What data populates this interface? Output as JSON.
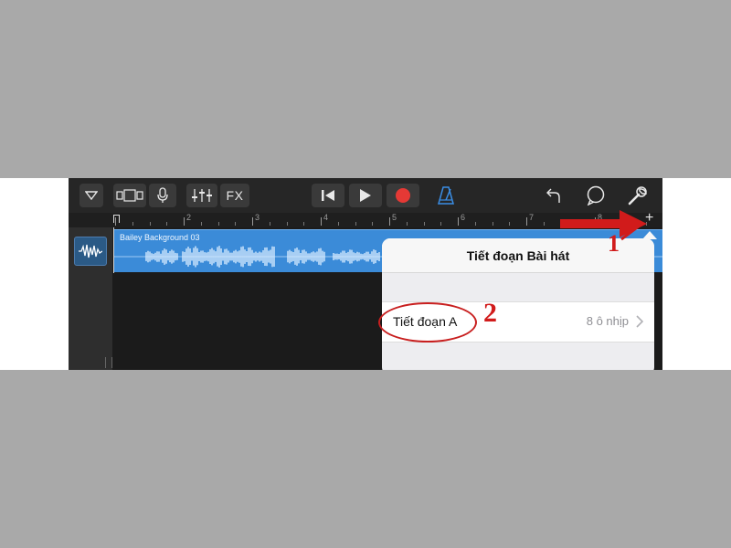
{
  "toolbar": {
    "fx_label": "FX",
    "icons": [
      "browser-toggle-icon",
      "view-toggle-icon",
      "microphone-icon",
      "mixer-icon",
      "fx-button",
      "go-to-start-icon",
      "play-icon",
      "record-icon",
      "metronome-icon",
      "undo-icon",
      "loop-icon",
      "settings-wrench-icon"
    ],
    "record_color": "#e53935",
    "metronome_color": "#3a8ee6"
  },
  "ruler": {
    "bars": [
      "2",
      "3",
      "4",
      "5",
      "6",
      "7",
      "8"
    ],
    "add_label": "+"
  },
  "track": {
    "icon": "audio-waveform-icon",
    "region_name": "Bailey Background 03",
    "region_color": "#3b8bd8"
  },
  "popover": {
    "title": "Tiết đoạn Bài hát",
    "rows": [
      {
        "label": "Tiết đoạn A",
        "value": "8 ô nhịp"
      }
    ]
  },
  "annotations": {
    "step1": "1",
    "step2": "2",
    "color": "#d11b1b"
  }
}
